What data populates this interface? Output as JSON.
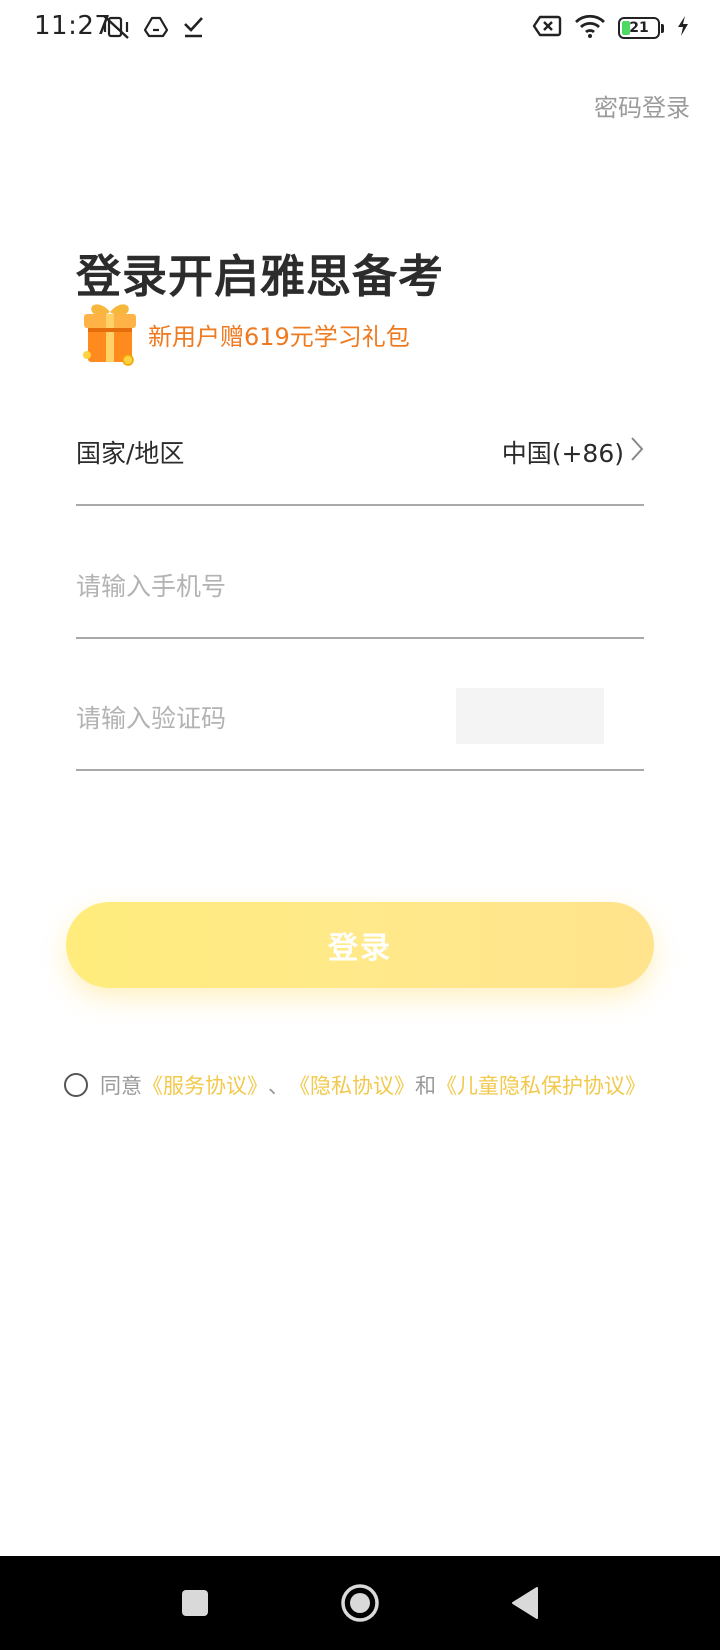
{
  "status_bar": {
    "time": "11:27",
    "left_icons": [
      "mute-vibrate-icon",
      "drive-icon",
      "download-done-icon"
    ],
    "right_icons": [
      "sim-off-icon",
      "wifi-icon",
      "battery-icon",
      "charging-icon"
    ],
    "battery_level": "21"
  },
  "header": {
    "password_login": "密码登录"
  },
  "title": {
    "main": "登录开启雅思备考",
    "promo": "新用户赠619元学习礼包"
  },
  "form": {
    "region_label": "国家/地区",
    "region_value": "中国(+86)",
    "phone_placeholder": "请输入手机号",
    "phone_value": "",
    "code_placeholder": "请输入验证码",
    "code_value": ""
  },
  "login_button": {
    "label": "登录"
  },
  "agreement": {
    "prefix": "同意",
    "service": "《服务协议》",
    "sep": "、",
    "privacy": "《隐私协议》",
    "and": "和",
    "child_privacy": "《儿童隐私保护协议》"
  },
  "colors": {
    "accent_yellow": "#FFE98A",
    "promo_orange": "#EF7A1F",
    "link_yellow": "#F2C94C"
  }
}
